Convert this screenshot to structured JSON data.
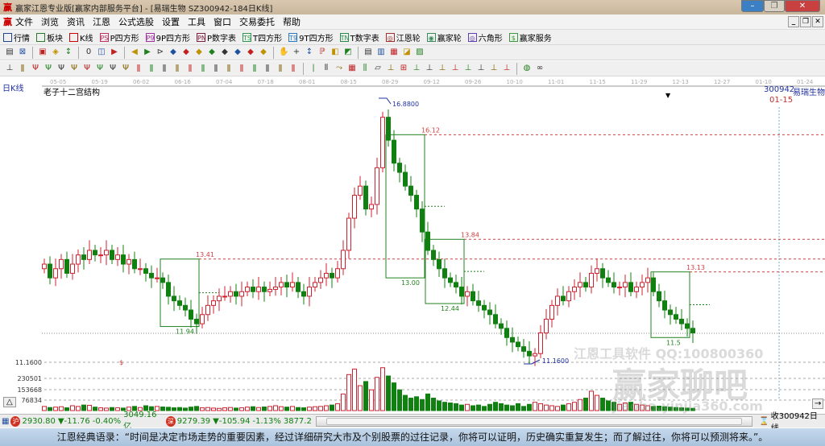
{
  "window": {
    "title": "赢家江恩专业版[赢家内部服务平台] - [易瑞生物  SZ300942-184日K线]",
    "logo": "赢"
  },
  "menu": [
    "文件",
    "浏览",
    "资讯",
    "江恩",
    "公式选股",
    "设置",
    "工具",
    "窗口",
    "交易委托",
    "帮助"
  ],
  "toolbar": [
    {
      "label": "行情",
      "icon": "grid-icon",
      "color": "#224488"
    },
    {
      "label": "板块",
      "icon": "blocks-icon",
      "color": "#2a7a2a"
    },
    {
      "label": "K线",
      "icon": "candles-icon",
      "color": "#c00"
    },
    {
      "label": "P四方形",
      "icon": "P4-icon",
      "color": "#c03060",
      "tag": "PS"
    },
    {
      "label": "9P四方形",
      "icon": "P9-icon",
      "color": "#a030a0",
      "tag": "P9"
    },
    {
      "label": "P数字表",
      "icon": "PN-icon",
      "color": "#802040",
      "tag": "PN"
    },
    {
      "label": "T四方形",
      "icon": "T4-icon",
      "color": "#2a9a4a",
      "tag": "TS"
    },
    {
      "label": "9T四方形",
      "icon": "T9-icon",
      "color": "#2a7ac0",
      "tag": "T9"
    },
    {
      "label": "T数字表",
      "icon": "TN-icon",
      "color": "#2a8a4a",
      "tag": "TN"
    },
    {
      "label": "江恩轮",
      "icon": "wheel-icon",
      "color": "#a03030",
      "tag": "◎"
    },
    {
      "label": "赢家轮",
      "icon": "wheel2-icon",
      "color": "#3a8a5a",
      "tag": "◉"
    },
    {
      "label": "六角形",
      "icon": "hexagon-icon",
      "color": "#6040b0",
      "tag": "◎"
    },
    {
      "label": "赢家服务",
      "icon": "dollar-icon",
      "color": "#3a9a3a",
      "tag": "$"
    }
  ],
  "chart_header": {
    "period": "日K线",
    "indicator": "老子十二宫结构",
    "code": "300942",
    "name": "易瑞生物",
    "cursor_date": "01-15"
  },
  "chart_data": {
    "type": "candlestick",
    "x_ticks": [
      "05-05",
      "05-19",
      "06-02",
      "06-16",
      "07-04",
      "07-18",
      "08-01",
      "08-15",
      "08-29",
      "09-12",
      "09-26",
      "10-10",
      "11-01",
      "11-15",
      "11-29",
      "12-13",
      "12-27",
      "01-10",
      "01-24"
    ],
    "ylim": [
      10.6,
      17.2
    ],
    "close": [
      13.3,
      13.0,
      13.2,
      13.4,
      13.1,
      13.3,
      13.5,
      13.4,
      13.6,
      13.5,
      13.5,
      13.6,
      13.4,
      13.5,
      13.3,
      13.4,
      13.2,
      13.2,
      13.1,
      13.0,
      13.0,
      12.9,
      12.6,
      12.5,
      12.4,
      12.3,
      12.1,
      12.0,
      12.2,
      12.4,
      12.5,
      12.6,
      12.6,
      12.7,
      12.6,
      12.7,
      12.8,
      12.7,
      12.8,
      12.7,
      12.75,
      12.8,
      12.9,
      12.8,
      12.9,
      12.7,
      12.6,
      12.8,
      12.9,
      13.0,
      13.1,
      13.0,
      13.2,
      13.6,
      14.3,
      14.8,
      15.0,
      14.5,
      14.6,
      15.4,
      16.5,
      16.0,
      15.5,
      15.3,
      15.0,
      14.8,
      14.5,
      14.0,
      13.6,
      13.4,
      13.2,
      13.0,
      12.9,
      12.8,
      12.6,
      12.7,
      12.5,
      12.4,
      12.3,
      12.2,
      12.0,
      11.9,
      11.7,
      11.6,
      11.5,
      11.4,
      11.3,
      11.35,
      11.8,
      12.1,
      12.4,
      12.6,
      12.5,
      12.7,
      12.8,
      12.9,
      12.8,
      13.1,
      13.2,
      13.0,
      12.9,
      12.8,
      12.8,
      12.9,
      12.7,
      12.8,
      12.9,
      13.0,
      12.7,
      12.5,
      12.3,
      12.2,
      12.1,
      12.0,
      11.9,
      11.8
    ],
    "volume": [
      30000,
      22000,
      25000,
      28000,
      20000,
      35000,
      30000,
      40000,
      38000,
      25000,
      20000,
      18000,
      22000,
      20000,
      18000,
      25000,
      30000,
      22000,
      35000,
      28000,
      30000,
      26000,
      24000,
      20000,
      22000,
      18000,
      25000,
      30000,
      20000,
      22000,
      18000,
      16000,
      20000,
      22000,
      18000,
      20000,
      25000,
      28000,
      22000,
      26000,
      30000,
      35000,
      28000,
      25000,
      30000,
      22000,
      20000,
      25000,
      28000,
      30000,
      35000,
      40000,
      50000,
      120000,
      260000,
      300000,
      180000,
      210000,
      150000,
      240000,
      310000,
      250000,
      200000,
      150000,
      110000,
      90000,
      100000,
      80000,
      120000,
      90000,
      70000,
      60000,
      55000,
      50000,
      40000,
      45000,
      35000,
      40000,
      30000,
      45000,
      60000,
      50000,
      40000,
      35000,
      50000,
      30000,
      45000,
      60000,
      50000,
      40000,
      35000,
      30000,
      40000,
      50000,
      60000,
      80000,
      90000,
      140000,
      110000,
      90000,
      70000,
      60000,
      45000,
      55000,
      60000,
      45000,
      40000,
      35000,
      30000,
      32000,
      28000,
      25000,
      22000,
      20000,
      18000,
      16000
    ],
    "volume_ticks": [
      "230501",
      "153668",
      "76834"
    ],
    "low_label": "11.1600",
    "high_label": "16.8800",
    "annotations": [
      {
        "from": 21,
        "to": 27,
        "top": 13.41,
        "bottom": 11.94,
        "top_label": "13.41",
        "bottom_label": "11.94"
      },
      {
        "from": 61,
        "to": 67,
        "top": 16.12,
        "bottom": 13.0,
        "top_label": "16.12",
        "bottom_label": "13.00"
      },
      {
        "from": 68,
        "to": 74,
        "top": 13.84,
        "bottom": 12.44,
        "top_label": "13.84",
        "bottom_label": "12.44"
      },
      {
        "from": 108,
        "to": 114,
        "top": 13.13,
        "bottom": 11.7,
        "top_label": "13.13",
        "bottom_label": "11.5"
      }
    ],
    "up_color": "#d02030",
    "down_color": "#108010",
    "level_color": "#d04040"
  },
  "watermark": {
    "line1": "江恩工具软件  QQ:100800360",
    "line2": "赢家聊吧",
    "line3": "jiaoba.yinjia360.com"
  },
  "status": {
    "sh_index": "2930.80",
    "sh_change": "▼-11.76",
    "sh_pct": "-0.40%",
    "sh_amount": "3049.16亿",
    "sz_index": "9279.39",
    "sz_change": "▼-105.94",
    "sz_pct": "-1.13%",
    "sz_amount": "3877.2",
    "sh_badge": "沪",
    "sz_badge": "深",
    "right_label": "收300942日线"
  },
  "quote": "江恩经典语录：“时间是决定市场走势的重要因素，经过详细研究大市及个别股票的过往记录，你将可以证明，历史确实重复发生；而了解过往，你将可以预测将来。”。"
}
